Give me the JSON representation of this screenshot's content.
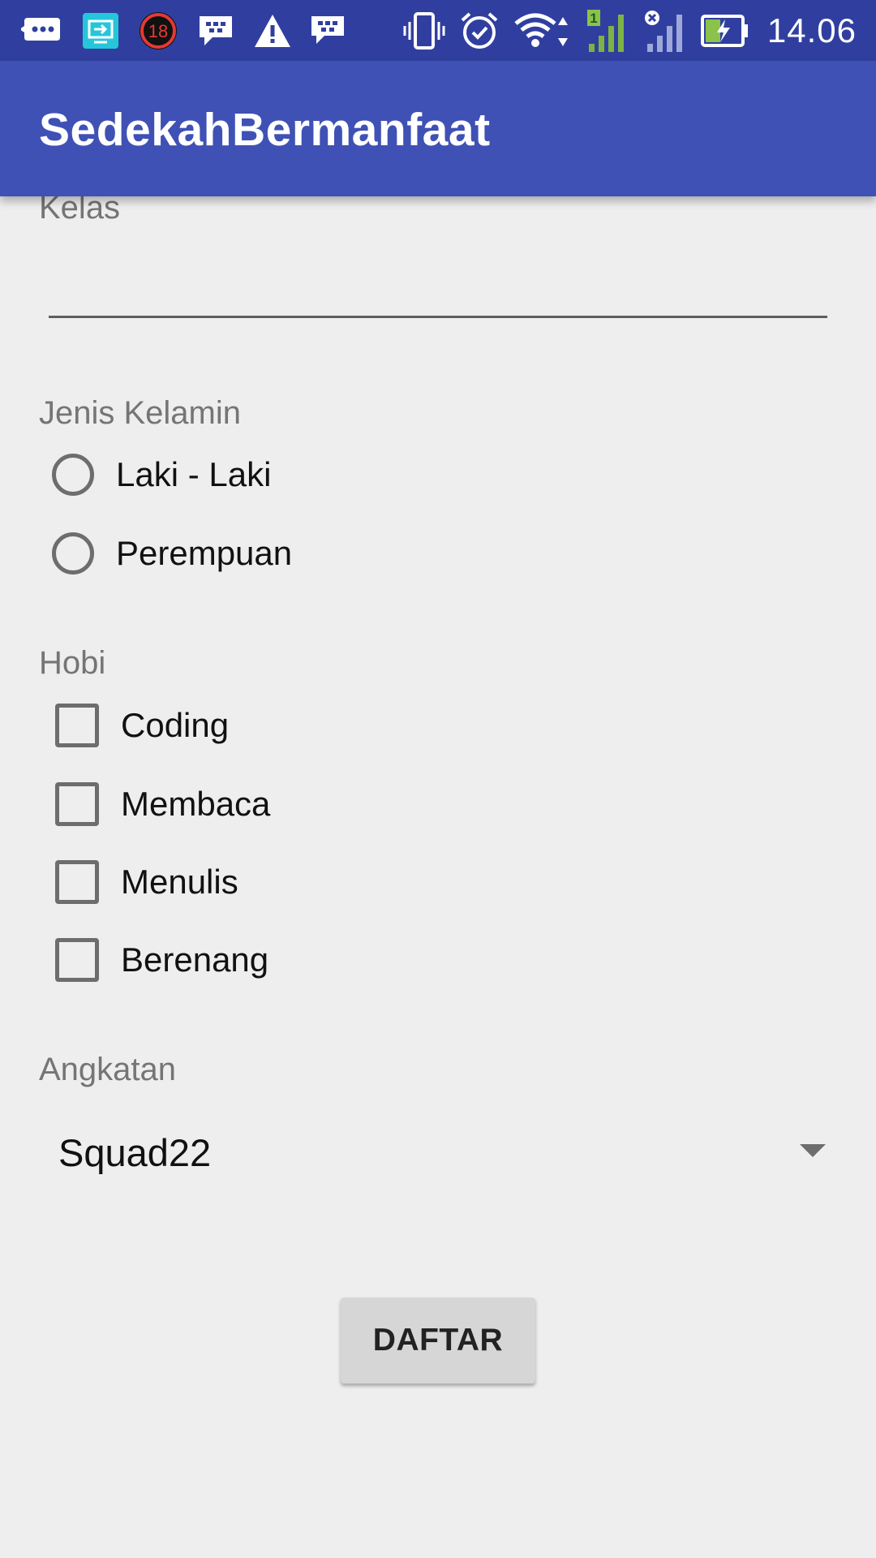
{
  "status_bar": {
    "time": "14.06",
    "notification_badge": "18",
    "signal_sim_label": "1",
    "icons_left": [
      "chat-bubble-icon",
      "screen-share-icon",
      "badge-18-icon",
      "bbm-chat-icon",
      "warning-icon",
      "bbm-icon"
    ],
    "icons_right": [
      "vibrate-icon",
      "alarm-icon",
      "wifi-icon",
      "signal-sim1-icon",
      "signal-sim2-icon",
      "battery-charging-icon"
    ],
    "color": "#303f9f"
  },
  "app_bar": {
    "title": "SedekahBermanfaat",
    "color": "#3f51b5"
  },
  "form": {
    "kelas_label": "Kelas",
    "kelas_value": "",
    "gender_label": "Jenis Kelamin",
    "gender_options": [
      "Laki - Laki",
      "Perempuan"
    ],
    "hobby_label": "Hobi",
    "hobby_options": [
      "Coding",
      "Membaca",
      "Menulis",
      "Berenang"
    ],
    "angkatan_label": "Angkatan",
    "angkatan_value": "Squad22",
    "submit_label": "DAFTAR"
  }
}
